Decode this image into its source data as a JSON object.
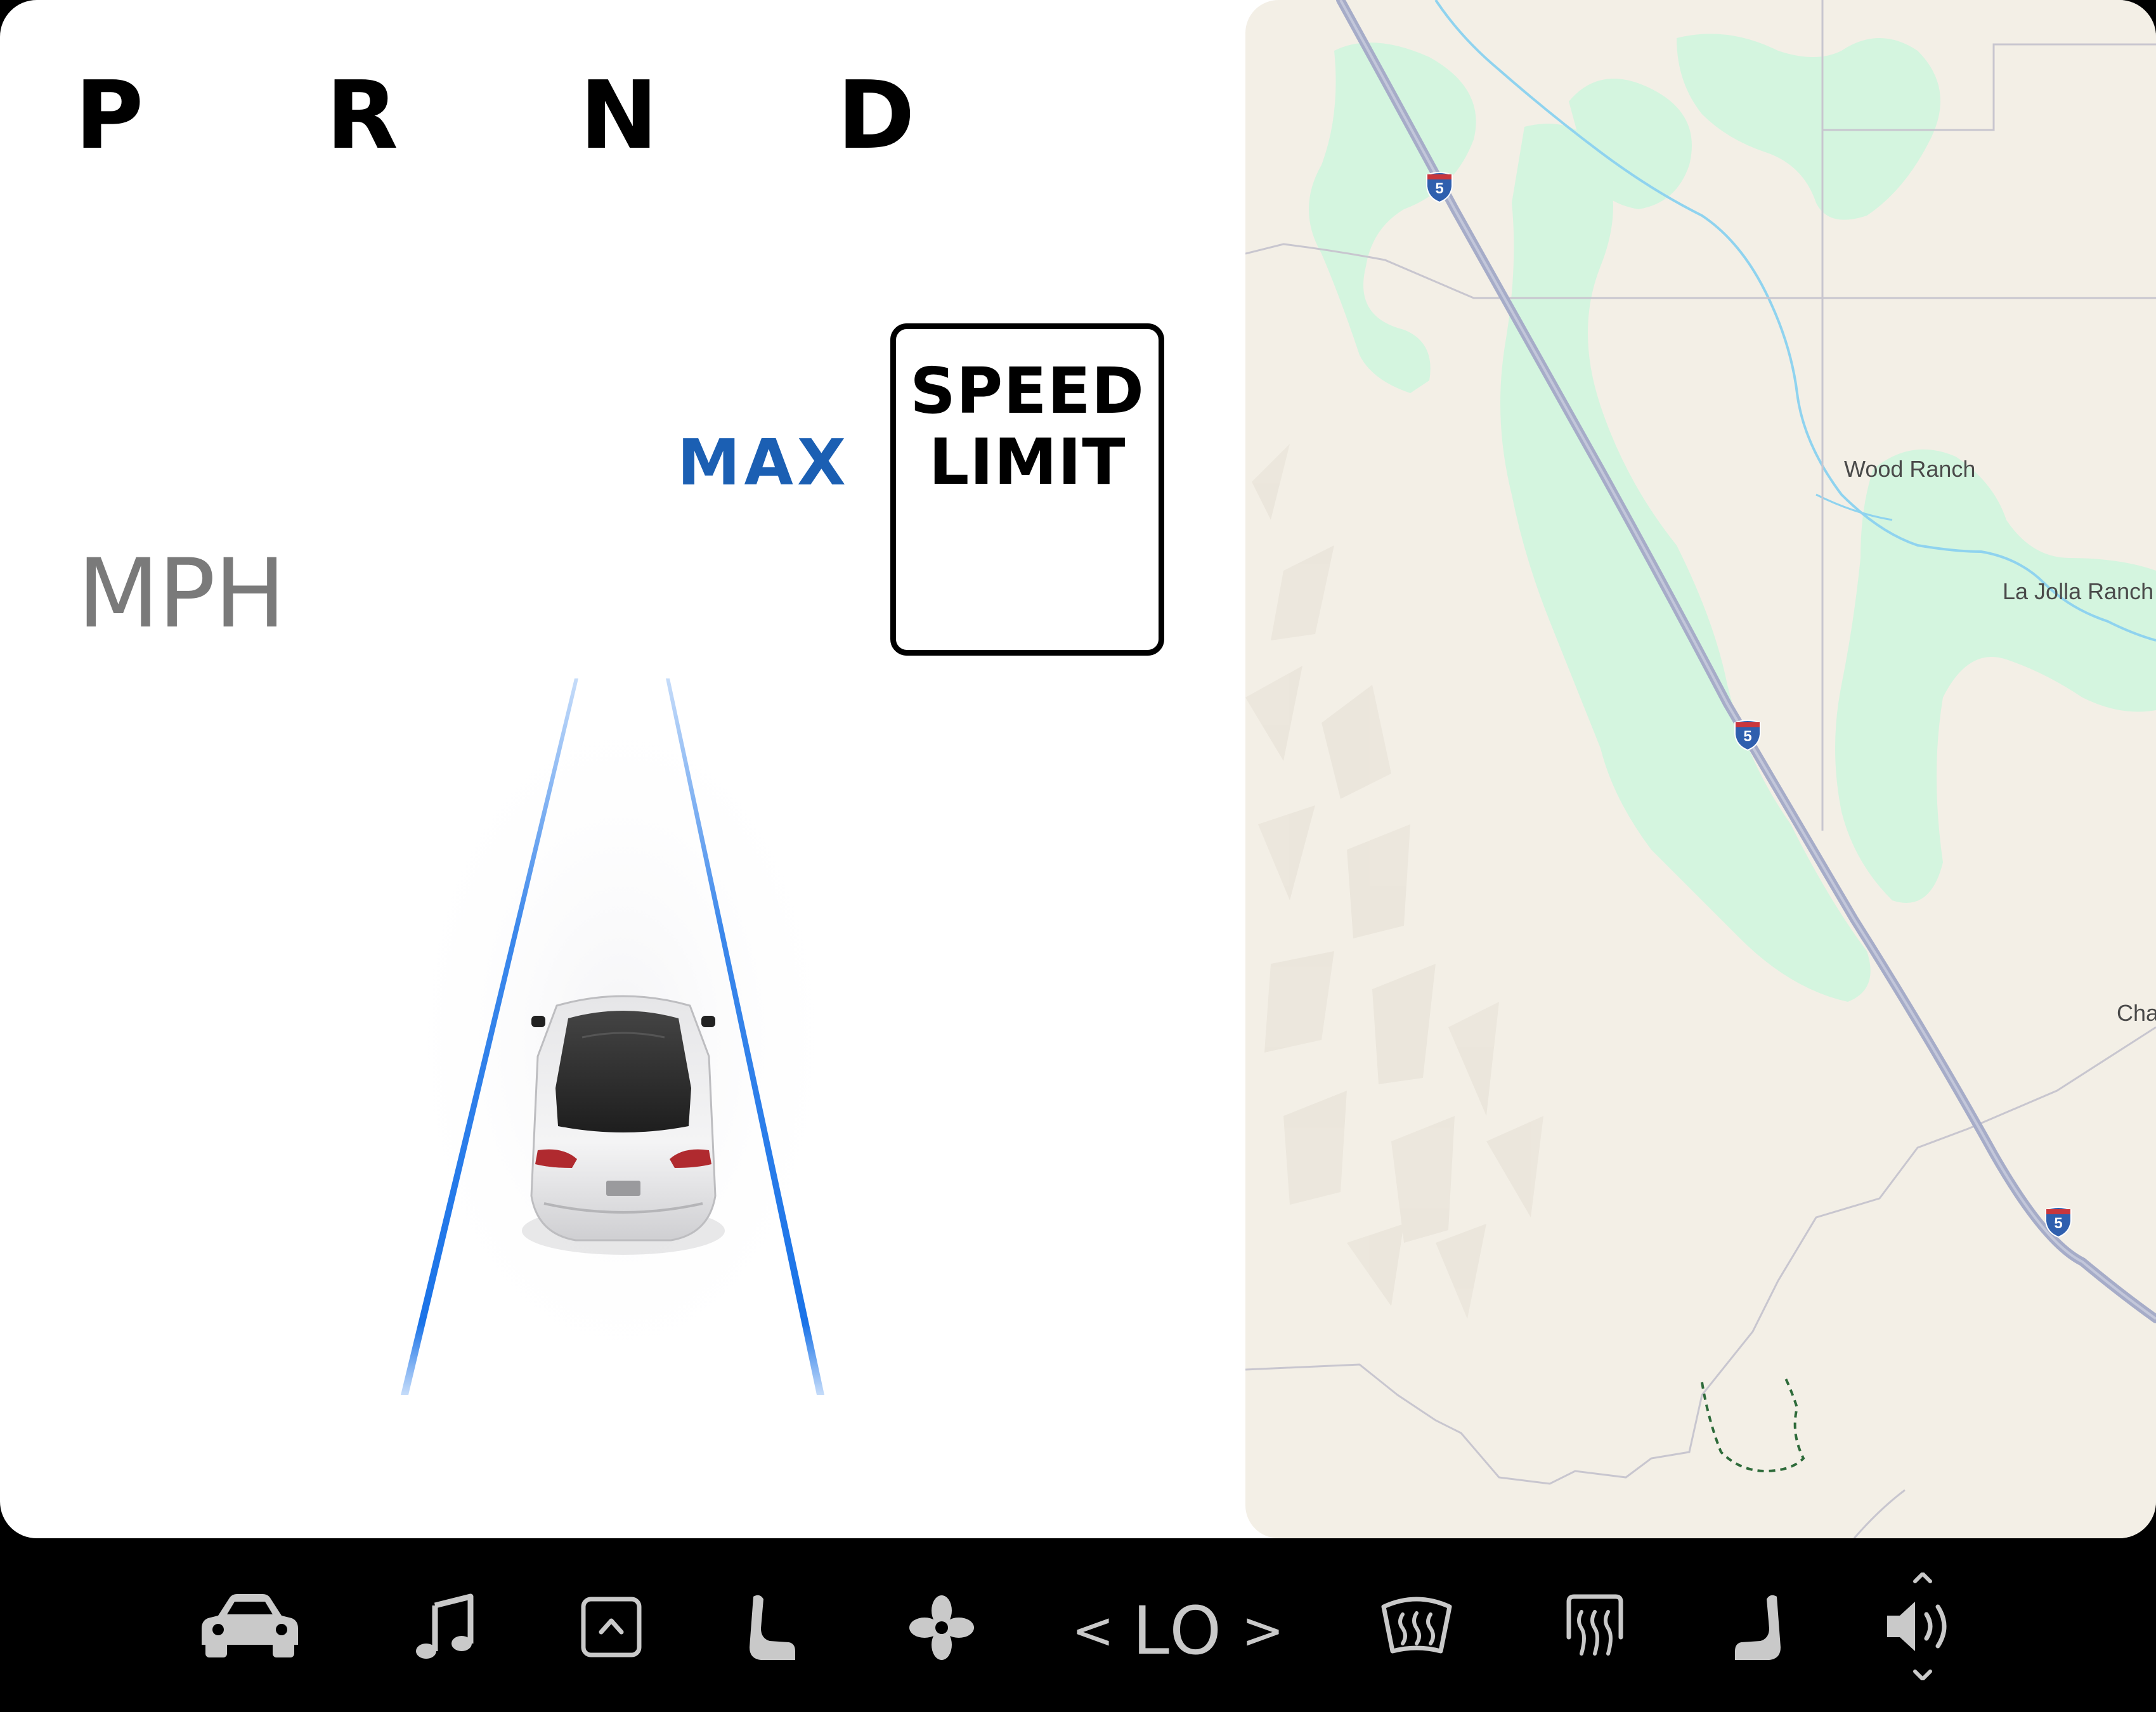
{
  "drive": {
    "gears": {
      "p": "P",
      "r": "R",
      "n": "N",
      "d": "D"
    },
    "speed_unit": "MPH",
    "max_label": "MAX",
    "speed_sign": {
      "line1": "SPEED",
      "line2": "LIMIT"
    }
  },
  "map": {
    "places": {
      "wood_ranch": "Wood Ranch",
      "la_jolla_ranch": "La Jolla Ranch",
      "cha": "Cha"
    },
    "route_shield_number": "5"
  },
  "dock": {
    "temperature": "LO",
    "temp_decrease": "<",
    "temp_increase": ">",
    "icons": [
      "car-icon",
      "music-note-icon",
      "launcher-up-icon",
      "driver-seat-icon",
      "fan-icon",
      "front-defrost-icon",
      "rear-defrost-icon",
      "passenger-seat-icon",
      "volume-icon"
    ]
  },
  "colors": {
    "lane_blue": "#1a73e8",
    "max_blue": "#1b5fb3",
    "map_land": "#f3efe6",
    "map_park": "#d4f5df",
    "map_highway": "#a6acc8",
    "map_water": "#8fd3ef",
    "dock_icon": "#c9c9c9"
  }
}
